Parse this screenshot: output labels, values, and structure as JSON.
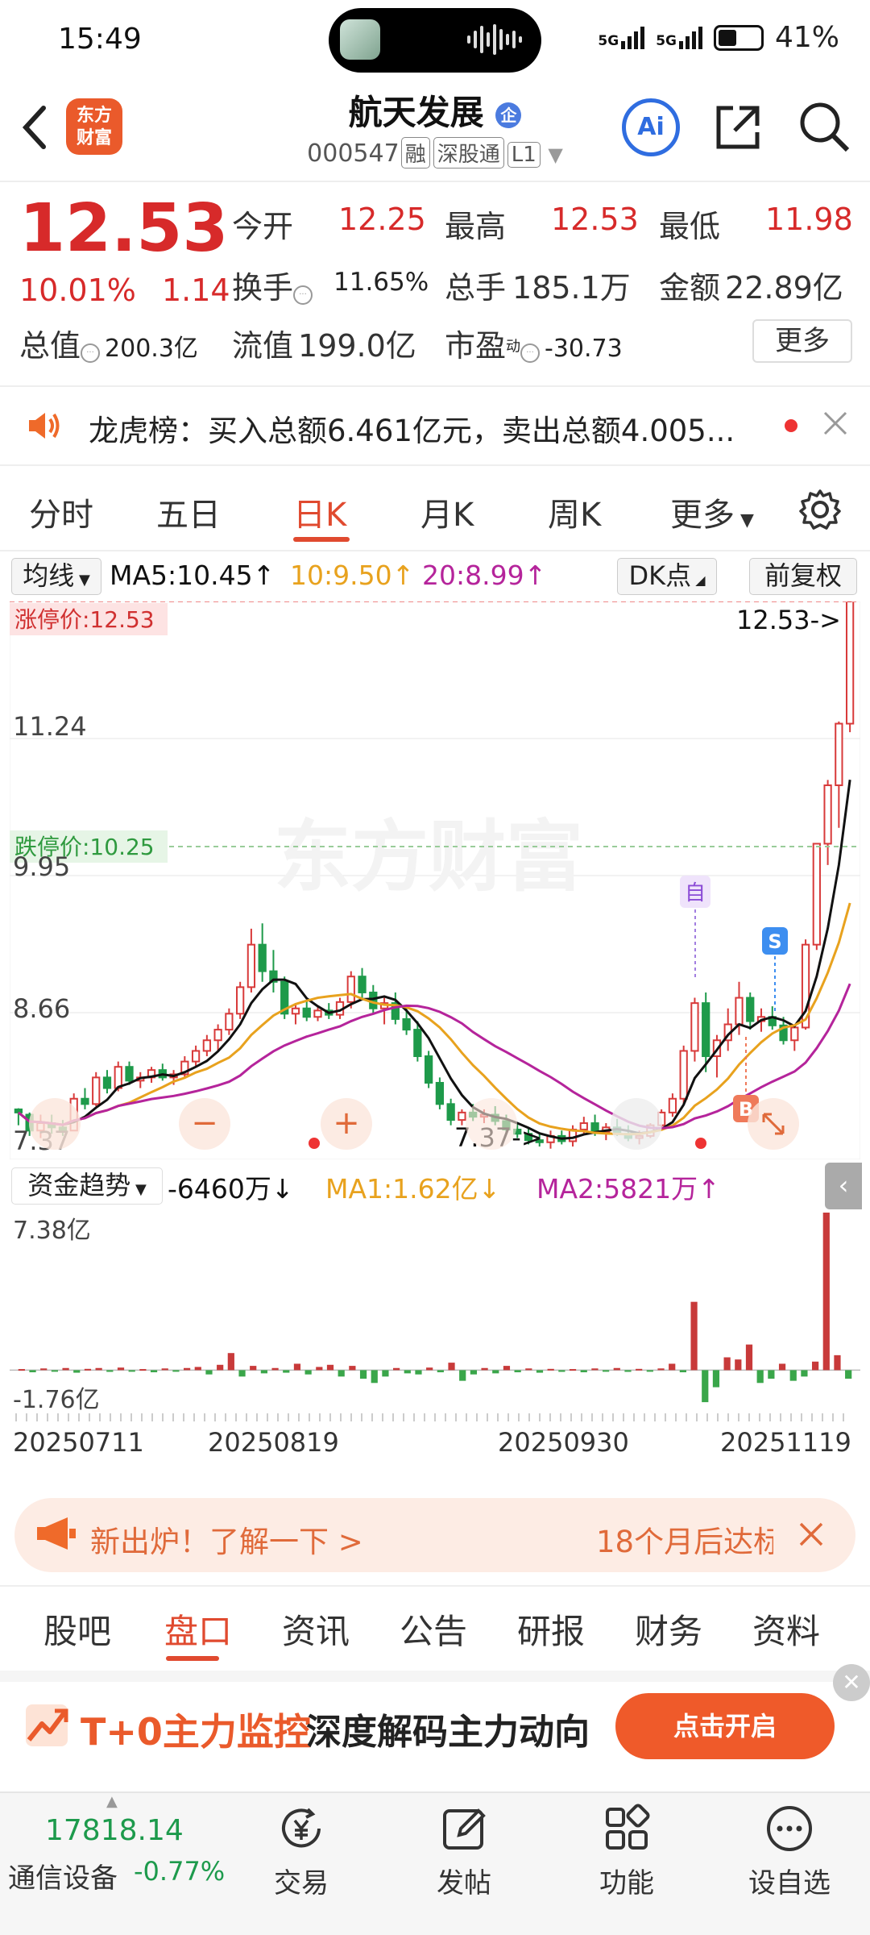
{
  "status_bar": {
    "time": "15:49",
    "signal1": "5G",
    "signal2": "5G",
    "battery": "41%"
  },
  "header": {
    "broker_logo": "东方财富",
    "stock_name": "航天发展",
    "stock_code": "000547",
    "tags": [
      "融",
      "深股通",
      "L1"
    ]
  },
  "quote": {
    "price": "12.53",
    "change_pct": "10.01%",
    "change_amt": "1.14",
    "open_label": "今开",
    "open": "12.25",
    "high_label": "最高",
    "high": "12.53",
    "low_label": "最低",
    "low": "11.98",
    "turnover_label": "换手",
    "turnover": "11.65%",
    "volume_label": "总手",
    "volume": "185.1万",
    "amount_label": "金额",
    "amount": "22.89亿",
    "mktcap_label": "总值",
    "mktcap": "200.3亿",
    "float_label": "流值",
    "float_cap": "199.0亿",
    "pe_label": "市盈",
    "pe_sup": "动",
    "pe": "-30.73",
    "more": "更多"
  },
  "notice": {
    "text": "龙虎榜：买入总额6.461亿元，卖出总额4.005..."
  },
  "kline_tabs": {
    "tabs": [
      "分时",
      "五日",
      "日K",
      "月K",
      "周K"
    ],
    "more": "更多",
    "active": "日K"
  },
  "ma_row": {
    "ma_label": "均线",
    "ma5": "MA5:10.45↑",
    "ma10": "10:9.50↑",
    "ma20": "20:8.99↑",
    "dk_label": "DK点",
    "adjust_label": "前复权"
  },
  "kchart": {
    "limit_up_label": "涨停价:12.53",
    "limit_down_label": "跌停价:10.25",
    "price_pointer": "12.53->",
    "low_pointer": "7.37->",
    "y_labels": [
      "11.24",
      "9.95",
      "8.66",
      "7.37"
    ],
    "marker_self": "自",
    "marker_sell": "S",
    "marker_buy": "B",
    "watermark": "东方财富",
    "ctrl_minus": "−",
    "ctrl_plus": "+"
  },
  "chart_data": {
    "type": "candlestick",
    "ylim": [
      7.37,
      12.53
    ],
    "ohlc": [
      [
        7.75,
        7.76,
        7.6,
        7.72
      ],
      [
        7.7,
        7.72,
        7.5,
        7.55
      ],
      [
        7.55,
        7.7,
        7.48,
        7.62
      ],
      [
        7.62,
        7.7,
        7.52,
        7.58
      ],
      [
        7.58,
        7.65,
        7.5,
        7.55
      ],
      [
        7.55,
        7.9,
        7.55,
        7.85
      ],
      [
        7.85,
        7.95,
        7.75,
        7.8
      ],
      [
        7.8,
        8.1,
        7.78,
        8.05
      ],
      [
        8.05,
        8.12,
        7.9,
        7.95
      ],
      [
        7.95,
        8.2,
        7.92,
        8.15
      ],
      [
        8.15,
        8.2,
        7.98,
        8.02
      ],
      [
        8.02,
        8.1,
        7.95,
        8.05
      ],
      [
        8.05,
        8.15,
        8.0,
        8.12
      ],
      [
        8.12,
        8.18,
        8.02,
        8.05
      ],
      [
        8.05,
        8.12,
        7.98,
        8.08
      ],
      [
        8.08,
        8.25,
        8.05,
        8.2
      ],
      [
        8.2,
        8.35,
        8.15,
        8.3
      ],
      [
        8.3,
        8.45,
        8.25,
        8.4
      ],
      [
        8.4,
        8.55,
        8.3,
        8.5
      ],
      [
        8.5,
        8.7,
        8.45,
        8.65
      ],
      [
        8.65,
        8.95,
        8.6,
        8.9
      ],
      [
        8.9,
        9.45,
        8.85,
        9.3
      ],
      [
        9.3,
        9.5,
        8.95,
        9.05
      ],
      [
        9.05,
        9.25,
        8.85,
        8.95
      ],
      [
        8.95,
        9.0,
        8.6,
        8.65
      ],
      [
        8.65,
        8.75,
        8.55,
        8.7
      ],
      [
        8.7,
        8.78,
        8.58,
        8.62
      ],
      [
        8.62,
        8.72,
        8.58,
        8.68
      ],
      [
        8.68,
        8.75,
        8.6,
        8.64
      ],
      [
        8.64,
        8.8,
        8.6,
        8.76
      ],
      [
        8.76,
        9.05,
        8.7,
        9.0
      ],
      [
        9.0,
        9.08,
        8.8,
        8.85
      ],
      [
        8.85,
        8.92,
        8.65,
        8.7
      ],
      [
        8.7,
        8.8,
        8.55,
        8.75
      ],
      [
        8.75,
        8.85,
        8.55,
        8.6
      ],
      [
        8.6,
        8.7,
        8.45,
        8.5
      ],
      [
        8.5,
        8.58,
        8.2,
        8.25
      ],
      [
        8.25,
        8.3,
        7.95,
        8.0
      ],
      [
        8.0,
        8.05,
        7.75,
        7.8
      ],
      [
        7.8,
        7.85,
        7.6,
        7.65
      ],
      [
        7.65,
        7.75,
        7.6,
        7.72
      ],
      [
        7.72,
        7.8,
        7.64,
        7.68
      ],
      [
        7.68,
        7.75,
        7.62,
        7.7
      ],
      [
        7.7,
        7.78,
        7.6,
        7.64
      ],
      [
        7.64,
        7.7,
        7.52,
        7.56
      ],
      [
        7.56,
        7.62,
        7.48,
        7.52
      ],
      [
        7.52,
        7.58,
        7.42,
        7.46
      ],
      [
        7.46,
        7.52,
        7.4,
        7.44
      ],
      [
        7.44,
        7.55,
        7.38,
        7.5
      ],
      [
        7.5,
        7.55,
        7.42,
        7.45
      ],
      [
        7.45,
        7.6,
        7.4,
        7.56
      ],
      [
        7.56,
        7.68,
        7.52,
        7.62
      ],
      [
        7.62,
        7.7,
        7.5,
        7.54
      ],
      [
        7.54,
        7.62,
        7.46,
        7.58
      ],
      [
        7.58,
        7.66,
        7.5,
        7.52
      ],
      [
        7.52,
        7.6,
        7.45,
        7.48
      ],
      [
        7.48,
        7.55,
        7.42,
        7.5
      ],
      [
        7.5,
        7.62,
        7.48,
        7.6
      ],
      [
        7.6,
        7.75,
        7.55,
        7.72
      ],
      [
        7.72,
        7.9,
        7.68,
        7.85
      ],
      [
        7.85,
        8.35,
        7.8,
        8.3
      ],
      [
        8.3,
        8.8,
        8.2,
        8.75
      ],
      [
        8.75,
        8.85,
        8.1,
        8.25
      ],
      [
        8.25,
        8.45,
        8.05,
        8.4
      ],
      [
        8.4,
        8.7,
        8.3,
        8.55
      ],
      [
        8.55,
        8.95,
        8.45,
        8.8
      ],
      [
        8.8,
        8.85,
        8.5,
        8.58
      ],
      [
        8.58,
        8.7,
        8.48,
        8.62
      ],
      [
        8.62,
        8.72,
        8.5,
        8.54
      ],
      [
        8.54,
        8.62,
        8.36,
        8.4
      ],
      [
        8.4,
        8.55,
        8.3,
        8.52
      ],
      [
        8.52,
        9.35,
        8.5,
        9.3
      ],
      [
        9.3,
        10.25,
        9.25,
        10.25
      ],
      [
        10.25,
        10.85,
        10.05,
        10.8
      ],
      [
        10.8,
        11.4,
        10.4,
        11.38
      ],
      [
        11.38,
        12.53,
        11.3,
        12.53
      ]
    ],
    "ma5_color": "#111111",
    "ma10_color": "#e8a21e",
    "ma20_color": "#b5249b"
  },
  "fund": {
    "label": "资金趋势",
    "value": "-6460万↓",
    "ma1": "MA1:1.62亿↓",
    "ma2": "MA2:5821万↑",
    "ymax_label": "7.38亿",
    "ymin_label": "-1.76亿",
    "ymax": 7.38,
    "ymin": -1.76,
    "bars": [
      0.05,
      -0.1,
      0.08,
      -0.06,
      0.1,
      -0.12,
      0.06,
      0.1,
      -0.08,
      0.12,
      -0.06,
      0.05,
      -0.1,
      0.08,
      -0.05,
      0.1,
      0.15,
      -0.2,
      0.25,
      0.8,
      -0.3,
      0.2,
      -0.15,
      0.1,
      -0.12,
      0.3,
      -0.2,
      0.15,
      0.25,
      -0.3,
      0.2,
      -0.4,
      -0.6,
      -0.3,
      0.1,
      -0.15,
      -0.2,
      0.12,
      -0.1,
      0.35,
      -0.5,
      -0.2,
      0.1,
      -0.15,
      0.2,
      -0.1,
      0.08,
      -0.12,
      0.06,
      -0.08,
      0.05,
      -0.1,
      0.08,
      -0.06,
      0.1,
      -0.08,
      0.06,
      -0.05,
      0.08,
      0.3,
      -0.1,
      3.2,
      -1.5,
      -0.8,
      0.6,
      0.5,
      1.2,
      -0.6,
      -0.4,
      0.3,
      -0.5,
      -0.3,
      0.4,
      7.38,
      0.7,
      -0.4
    ]
  },
  "dates": [
    "20250711",
    "20250819",
    "20250930",
    "20251119"
  ],
  "promo": {
    "title": "新出炉！了解一下 >",
    "right": "18个月后达标"
  },
  "bottom_tabs": {
    "tabs": [
      "股吧",
      "盘口",
      "资讯",
      "公告",
      "研报",
      "财务",
      "资料"
    ],
    "active": "盘口"
  },
  "ad": {
    "title1": "T+0主力监控",
    "title2": "深度解码主力动向",
    "button": "点击开启"
  },
  "bottom_nav": {
    "index_value": "17818.14",
    "index_name": "通信设备",
    "index_change": "-0.77%",
    "items": [
      "交易",
      "发帖",
      "功能",
      "设自选"
    ]
  }
}
